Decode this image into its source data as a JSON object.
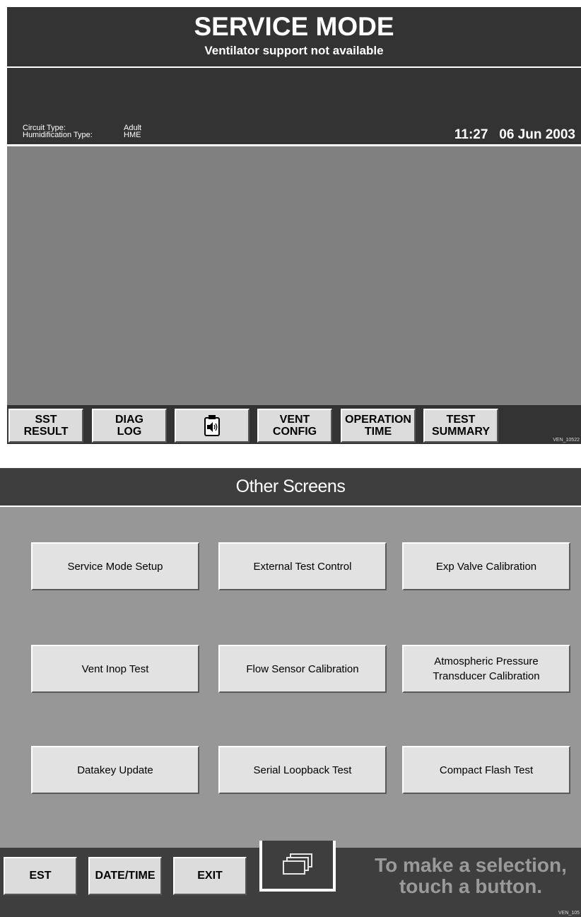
{
  "upper": {
    "title": "SERVICE MODE",
    "subtitle": "Ventilator support not available",
    "info": {
      "circuit_label": "Circuit Type:",
      "circuit_value": "Adult",
      "humid_label": "Humidification Type:",
      "humid_value": "HME"
    },
    "clock": {
      "time": "11:27",
      "date": "06 Jun 2003"
    },
    "buttons": {
      "sst": "SST\nRESULT",
      "diag": "DIAG\nLOG",
      "vent_config": "VENT\nCONFIG",
      "operation_time": "OPERATION\nTIME",
      "test_summary": "TEST\nSUMMARY"
    },
    "figure_id": "VEN_10522"
  },
  "lower": {
    "title": "Other Screens",
    "buttons": {
      "service_mode_setup": "Service Mode Setup",
      "external_test_control": "External Test Control",
      "exp_valve_calibration": "Exp Valve Calibration",
      "vent_inop_test": "Vent Inop Test",
      "flow_sensor_calibration": "Flow Sensor Calibration",
      "atmospheric_pressure": "Atmospheric Pressure\nTransducer Calibration",
      "datakey_update": "Datakey Update",
      "serial_loopback_test": "Serial Loopback Test",
      "compact_flash_test": "Compact Flash Test"
    },
    "footer": {
      "est": "EST",
      "date_time": "DATE/TIME",
      "exit": "EXIT",
      "prompt": "To make a selection,\ntouch a button."
    },
    "figure_id": "VEN_105"
  }
}
